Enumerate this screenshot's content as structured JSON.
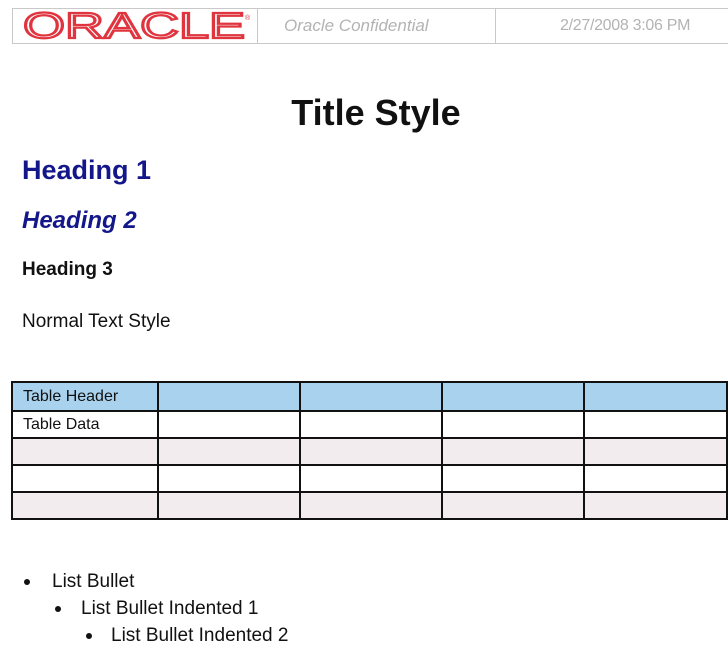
{
  "header": {
    "logo_text": "ORACLE",
    "logo_color": "#e0343f",
    "confidential_label": "Oracle Confidential",
    "date_text": "2/27/2008 3:06 PM"
  },
  "document": {
    "title": "Title Style",
    "heading1": "Heading 1",
    "heading2": "Heading 2",
    "heading3": "Heading 3",
    "normal_text": "Normal Text Style"
  },
  "table": {
    "header_cells": [
      "Table Header",
      "",
      "",
      "",
      ""
    ],
    "rows": [
      [
        "Table Data",
        "",
        "",
        "",
        ""
      ],
      [
        "",
        "",
        "",
        "",
        ""
      ],
      [
        "",
        "",
        "",
        "",
        ""
      ],
      [
        "",
        "",
        "",
        "",
        ""
      ]
    ],
    "header_color": "#a9d2ee",
    "shade_color": "#f3ecef"
  },
  "bullets": [
    {
      "text": "List Bullet",
      "level": 0
    },
    {
      "text": "List Bullet Indented 1",
      "level": 1
    },
    {
      "text": "List Bullet Indented 2",
      "level": 2
    }
  ],
  "colors": {
    "heading_blue": "#14178a",
    "header_gray_text": "#b3b3b3"
  }
}
